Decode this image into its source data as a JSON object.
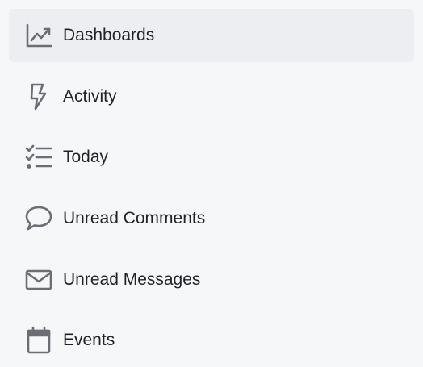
{
  "sidebar": {
    "items": [
      {
        "label": "Dashboards",
        "icon": "chart-line-icon",
        "active": true
      },
      {
        "label": "Activity",
        "icon": "bolt-icon",
        "active": false
      },
      {
        "label": "Today",
        "icon": "checklist-icon",
        "active": false
      },
      {
        "label": "Unread Comments",
        "icon": "speech-bubble-icon",
        "active": false
      },
      {
        "label": "Unread Messages",
        "icon": "envelope-icon",
        "active": false
      },
      {
        "label": "Events",
        "icon": "calendar-icon",
        "active": false
      }
    ]
  },
  "colors": {
    "background": "#f6f7f9",
    "active_background": "#eceef2",
    "text": "#1f2328",
    "icon": "#6b6f75"
  }
}
